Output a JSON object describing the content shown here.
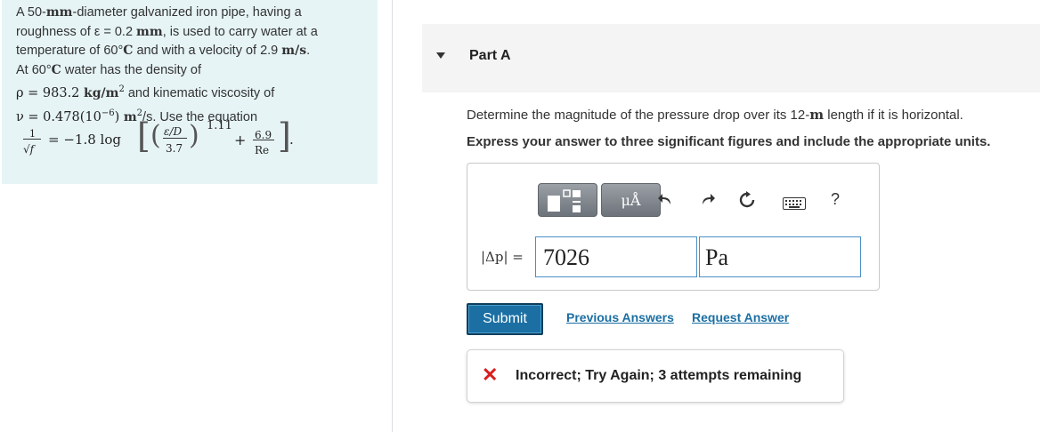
{
  "problem": {
    "line1": {
      "pre": "A 50-",
      "mm": "mm",
      "post": "-diameter galvanized iron pipe, having a"
    },
    "line2": {
      "pre": "roughness of ε = 0.2 ",
      "mm": "mm",
      "post": ", is used to carry water at a"
    },
    "line3": {
      "pre": "temperature of 60",
      "deg": "°",
      "C": "C",
      "post": " and with a velocity of 2.9 ",
      "unit": "m/s",
      "end": "."
    },
    "line4": {
      "pre": "At 60",
      "deg": "°",
      "C": "C",
      "post": " water has the density of"
    },
    "line5": {
      "pre": "ρ = 983.2 ",
      "unit": "kg/m",
      "exp": "2",
      "post": " and kinematic viscosity of"
    },
    "line6": {
      "pre": "ν = 0.478(10",
      "exp": "−6",
      "mid": ") ",
      "unit": "m",
      "exp2": "2",
      "post": "/s. Use the equation"
    }
  },
  "equation": {
    "lhs_num": "1",
    "lhs_den": "√f",
    "equals": "= −1.8 log",
    "inner_num": "ε/D",
    "inner_den": "3.7",
    "power": "1.11",
    "plus": "+",
    "frac2_num": "6.9",
    "frac2_den": "Re",
    "end": "."
  },
  "part": {
    "title": "Part A"
  },
  "question": {
    "pre": "Determine the magnitude of the pressure drop over its 12-",
    "unit": "m",
    "post": " length if it is horizontal.",
    "instruction": "Express your answer to three significant figures and include the appropriate units."
  },
  "toolbar": {
    "units_btn": "μÅ",
    "help": "?"
  },
  "answer": {
    "label": "|Δp| =",
    "value": "7026",
    "units": "Pa"
  },
  "actions": {
    "submit": "Submit",
    "previous_answers": "Previous Answers",
    "request_answer": "Request Answer"
  },
  "feedback": {
    "icon": "✕",
    "text": "Incorrect; Try Again; 3 attempts remaining"
  },
  "colors": {
    "problem_bg": "#e6f4f6",
    "accent_blue": "#1b6fa3",
    "error_red": "#d81e1e",
    "header_bg": "#f4f4f4"
  }
}
